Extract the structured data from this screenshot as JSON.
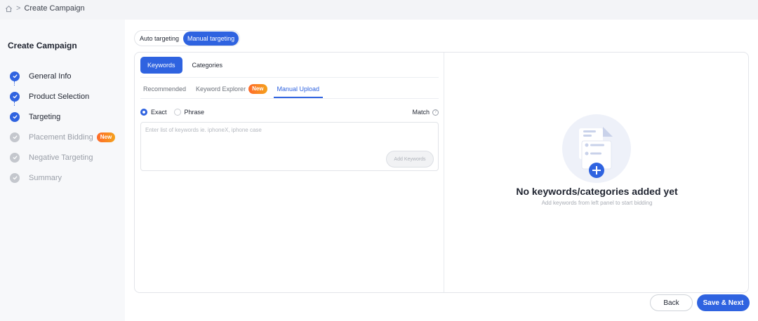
{
  "breadcrumb": {
    "separator": ">",
    "current": "Create Campaign"
  },
  "sidebar": {
    "title": "Create Campaign",
    "steps": [
      {
        "label": "General Info",
        "status": "done"
      },
      {
        "label": "Product Selection",
        "status": "done"
      },
      {
        "label": "Targeting",
        "status": "done"
      },
      {
        "label": "Placement Bidding",
        "status": "todo",
        "badge": "New"
      },
      {
        "label": "Negative Targeting",
        "status": "todo"
      },
      {
        "label": "Summary",
        "status": "todo"
      }
    ]
  },
  "targeting_toggle": {
    "options": [
      "Auto targeting",
      "Manual targeting"
    ],
    "selected": "Manual targeting"
  },
  "type_tabs": {
    "items": [
      "Keywords",
      "Categories"
    ],
    "selected": "Keywords"
  },
  "sub_tabs": {
    "items": [
      {
        "label": "Recommended"
      },
      {
        "label": "Keyword Explorer",
        "badge": "New"
      },
      {
        "label": "Manual Upload"
      }
    ],
    "selected": "Manual Upload"
  },
  "match_type": {
    "options": [
      "Exact",
      "Phrase"
    ],
    "selected": "Exact",
    "label": "Match"
  },
  "keyword_input": {
    "placeholder": "Enter list of keywords ie. iphoneX, iphone case",
    "value": ""
  },
  "add_keywords_button": "Add Keywords",
  "empty_state": {
    "title": "No keywords/categories added yet",
    "subtitle": "Add keywords from left panel to start bidding"
  },
  "footer": {
    "back_label": "Back",
    "next_label": "Save & Next"
  },
  "colors": {
    "accent": "#2f63e0",
    "badge_start": "#ff6a2a",
    "badge_end": "#f4a21d",
    "step_inactive": "#c4c7cd"
  }
}
